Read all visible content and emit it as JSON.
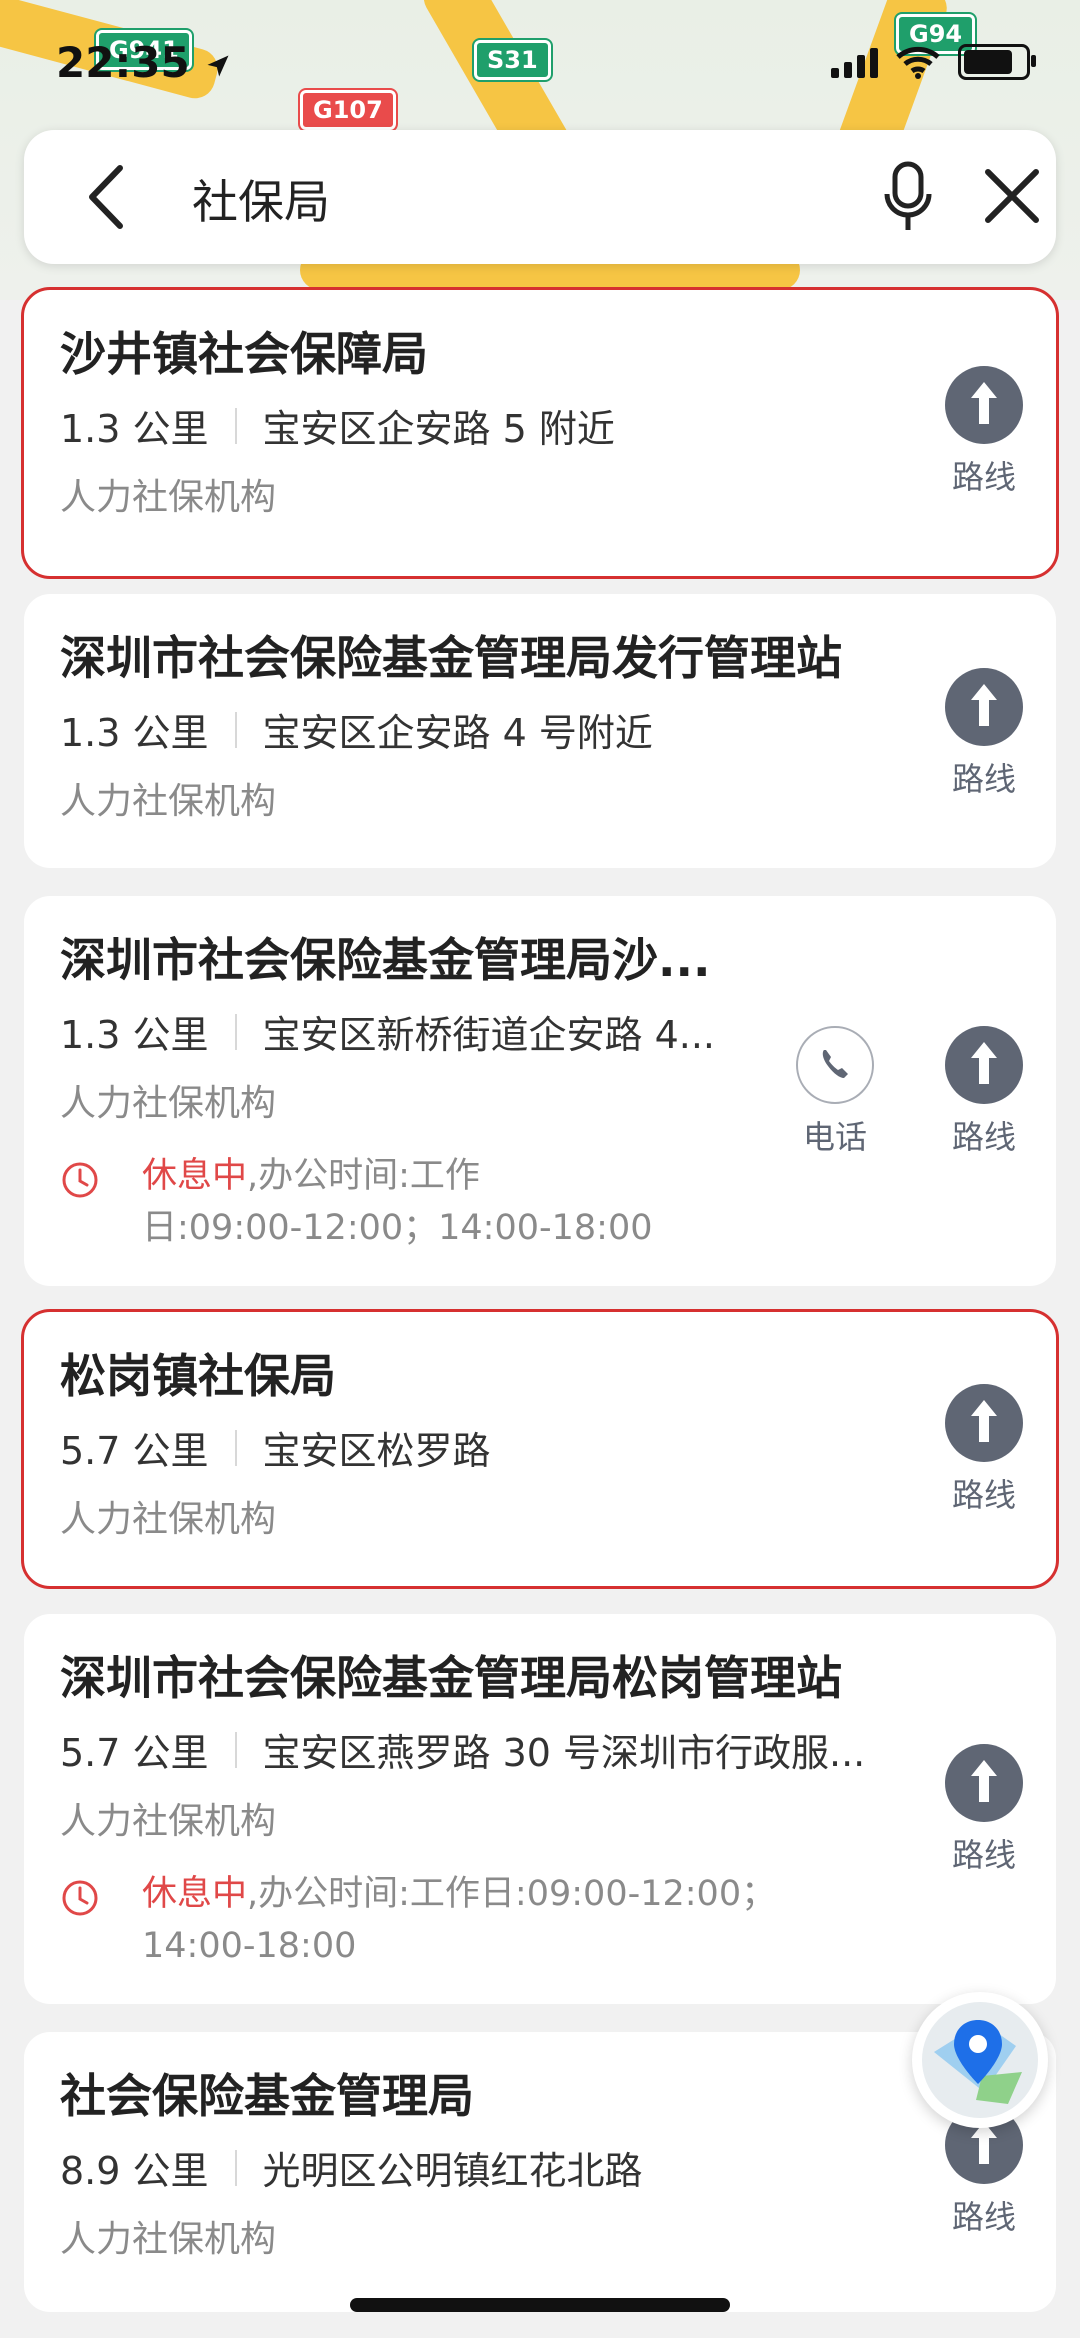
{
  "map": {
    "shields": [
      "G94",
      "S31",
      "G107",
      "G941"
    ]
  },
  "status_bar": {
    "time": "22:35"
  },
  "search": {
    "query": "社保局"
  },
  "results": [
    {
      "title": "沙井镇社会保障局",
      "distance": "1.3 公里",
      "address": "宝安区企安路 5 附近",
      "category": "人力社保机构",
      "route_label": "路线",
      "highlighted": true
    },
    {
      "title": "深圳市社会保险基金管理局发行管理站",
      "distance": "1.3 公里",
      "address": "宝安区企安路 4 号附近",
      "category": "人力社保机构",
      "route_label": "路线",
      "highlighted": false
    },
    {
      "title": "深圳市社会保险基金管理局沙...",
      "distance": "1.3 公里",
      "address": "宝安区新桥街道企安路 4...",
      "category": "人力社保机构",
      "phone_label": "电话",
      "route_label": "路线",
      "hours_status": "休息中",
      "hours_line1": ",办公时间:工作",
      "hours_line2": "日:09:00-12:00；14:00-18:00",
      "highlighted": false
    },
    {
      "title": "松岗镇社保局",
      "distance": "5.7 公里",
      "address": "宝安区松罗路",
      "category": "人力社保机构",
      "route_label": "路线",
      "highlighted": true
    },
    {
      "title": "深圳市社会保险基金管理局松岗管理站",
      "distance": "5.7 公里",
      "address": "宝安区燕罗路 30 号深圳市行政服...",
      "category": "人力社保机构",
      "route_label": "路线",
      "hours_status": "休息中",
      "hours_line1": ",办公时间:工作日:09:00-12:00；",
      "hours_line2": "14:00-18:00",
      "highlighted": false
    },
    {
      "title": "社会保险基金管理局",
      "distance": "8.9 公里",
      "address": "光明区公明镇红花北路",
      "category": "人力社保机构",
      "route_label": "路线",
      "highlighted": false
    }
  ],
  "colors": {
    "highlight_border": "#d63030",
    "rest_status": "#e04848",
    "route_button": "#5f6674"
  }
}
